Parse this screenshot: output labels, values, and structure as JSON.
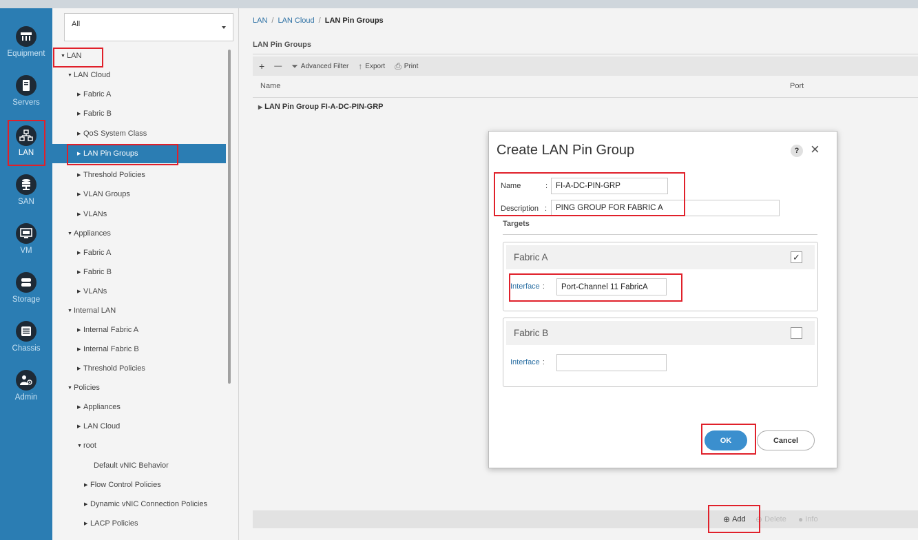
{
  "nav": {
    "items": [
      {
        "label": "Equipment",
        "icon": "equipment-icon"
      },
      {
        "label": "Servers",
        "icon": "servers-icon"
      },
      {
        "label": "LAN",
        "icon": "lan-icon"
      },
      {
        "label": "SAN",
        "icon": "san-icon"
      },
      {
        "label": "VM",
        "icon": "vm-icon"
      },
      {
        "label": "Storage",
        "icon": "storage-icon"
      },
      {
        "label": "Chassis",
        "icon": "chassis-icon"
      },
      {
        "label": "Admin",
        "icon": "admin-icon"
      }
    ],
    "active": "LAN"
  },
  "filter": {
    "value": "All"
  },
  "tree": {
    "items": [
      {
        "label": "LAN",
        "expanded": true
      },
      {
        "label": "LAN Cloud",
        "expanded": true
      },
      {
        "label": "Fabric A",
        "expanded": false
      },
      {
        "label": "Fabric B",
        "expanded": false
      },
      {
        "label": "QoS System Class",
        "expanded": false
      },
      {
        "label": "LAN Pin Groups",
        "expanded": false,
        "selected": true
      },
      {
        "label": "Threshold Policies",
        "expanded": false
      },
      {
        "label": "VLAN Groups",
        "expanded": false
      },
      {
        "label": "VLANs",
        "expanded": false
      },
      {
        "label": "Appliances",
        "expanded": true
      },
      {
        "label": "Fabric A",
        "expanded": false
      },
      {
        "label": "Fabric B",
        "expanded": false
      },
      {
        "label": "VLANs",
        "expanded": false
      },
      {
        "label": "Internal LAN",
        "expanded": true
      },
      {
        "label": "Internal Fabric A",
        "expanded": false
      },
      {
        "label": "Internal Fabric B",
        "expanded": false
      },
      {
        "label": "Threshold Policies",
        "expanded": false
      },
      {
        "label": "Policies",
        "expanded": true
      },
      {
        "label": "Appliances",
        "expanded": false
      },
      {
        "label": "LAN Cloud",
        "expanded": false
      },
      {
        "label": "root",
        "expanded": true
      },
      {
        "label": "Default vNIC Behavior",
        "leaf": true
      },
      {
        "label": "Flow Control Policies",
        "expanded": false
      },
      {
        "label": "Dynamic vNIC Connection Policies",
        "expanded": false
      },
      {
        "label": "LACP Policies",
        "expanded": false
      }
    ]
  },
  "breadcrumb": {
    "part1": "LAN",
    "part2": "LAN Cloud",
    "current": "LAN Pin Groups",
    "separator": "/"
  },
  "main": {
    "section_title": "LAN Pin Groups",
    "toolbar": {
      "add": "+",
      "remove": "—",
      "advanced_filter": "Advanced Filter",
      "export": "Export",
      "print": "Print"
    },
    "columns": {
      "name": "Name",
      "port": "Port"
    },
    "rows": [
      {
        "label": "LAN Pin Group FI-A-DC-PIN-GRP"
      }
    ]
  },
  "bottom_bar": {
    "add": "Add",
    "delete": "Delete",
    "info": "Info"
  },
  "dialog": {
    "title": "Create LAN Pin Group",
    "help": "?",
    "close": "×",
    "name_label": "Name",
    "name_value": "FI-A-DC-PIN-GRP",
    "description_label": "Description",
    "description_value": "PING GROUP FOR FABRIC A",
    "colon": ":",
    "targets_label": "Targets",
    "fabric_a": {
      "title": "Fabric A",
      "checked": true,
      "interface_label": "Interface",
      "interface_value": "Port-Channel 11 FabricA"
    },
    "fabric_b": {
      "title": "Fabric B",
      "checked": false,
      "interface_label": "Interface",
      "interface_value": ""
    },
    "ok": "OK",
    "cancel": "Cancel"
  },
  "colors": {
    "accent": "#2b7db3",
    "nav_bg": "#2b7db3",
    "ok_button": "#3b8fce",
    "highlight": "#e0202a",
    "link": "#2b6fa3"
  }
}
